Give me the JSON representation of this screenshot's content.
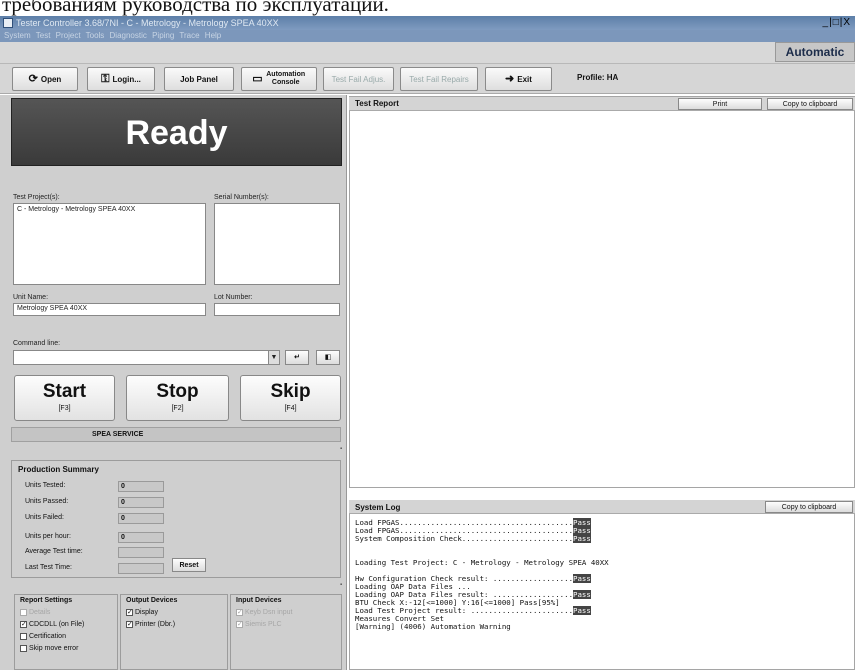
{
  "caption": "требованиям руководства по эксплуатации.",
  "window": {
    "title": "Tester Controller 3.68/7NI - C - Metrology - Metrology SPEA 40XX",
    "controls": "_|□|X"
  },
  "menu": "System  Test Project  Tools  Diagnostic  Piping Trace  Help",
  "mode_badge": "Automatic",
  "toolbar": {
    "open": "Open",
    "login": "Login...",
    "job_panel": "Job Panel",
    "automation_console": "Automation Console",
    "test_fail_adjust": "Test Fail Adjus.",
    "test_fail_repairs": "Test Fail Repairs",
    "exit": "Exit",
    "profile": "Profile: HA"
  },
  "status_banner": "Ready",
  "fields": {
    "test_project_label": "Test Project(s):",
    "test_project_value": "C - Metrology - Metrology SPEA 40XX",
    "serial_label": "Serial Number(s):",
    "serial_value": "",
    "unit_name_label": "Unit Name:",
    "unit_name_value": "Metrology SPEA 40XX",
    "lot_label": "Lot Number:",
    "lot_value": "",
    "command_label": "Command line:"
  },
  "buttons": {
    "start": "Start",
    "start_key": "[F3]",
    "stop": "Stop",
    "stop_key": "[F2]",
    "skip": "Skip",
    "skip_key": "[F4]"
  },
  "service_text": "SPEA SERVICE",
  "production": {
    "title": "Production Summary",
    "tested_label": "Units Tested:",
    "tested": "0",
    "passed_label": "Units Passed:",
    "passed": "0",
    "failed_label": "Units Failed:",
    "failed": "0",
    "per_hour_label": "Units per hour:",
    "per_hour": "0",
    "avg_label": "Average Test time:",
    "avg": "",
    "last_label": "Last Test Time:",
    "last": "",
    "reset": "Reset"
  },
  "report_settings": {
    "title": "Report Settings",
    "opts": [
      {
        "label": "Details",
        "checked": false,
        "disabled": true
      },
      {
        "label": "CDCDLL (on File)",
        "checked": true,
        "disabled": false
      },
      {
        "label": "Certification",
        "checked": false,
        "disabled": false
      },
      {
        "label": "Skip move error",
        "checked": false,
        "disabled": false
      }
    ]
  },
  "output_devices": {
    "title": "Output Devices",
    "opts": [
      {
        "label": "Display",
        "checked": true
      },
      {
        "label": "Printer (Dbr.)",
        "checked": true
      }
    ]
  },
  "input_devices": {
    "title": "Input Devices",
    "opts": [
      {
        "label": "Keyb Dsn input",
        "checked": true
      },
      {
        "label": "Siemis PLC",
        "checked": true
      }
    ]
  },
  "test_report": {
    "title": "Test Report",
    "print": "Print",
    "copy": "Copy to clipboard"
  },
  "system_log": {
    "title": "System Log",
    "copy": "Copy to clipboard",
    "lines": [
      {
        "text": "Load FPGAS.......................................",
        "status": "Pass"
      },
      {
        "text": "Load FPGAS.......................................",
        "status": "Pass"
      },
      {
        "text": "System Composition Check.........................",
        "status": "Pass"
      },
      {
        "text": "",
        "status": ""
      },
      {
        "text": "",
        "status": ""
      },
      {
        "text": "Loading Test Project: C - Metrology - Metrology SPEA 40XX",
        "status": ""
      },
      {
        "text": "",
        "status": ""
      },
      {
        "text": "Hw Configuration Check result: ..................",
        "status": "Pass"
      },
      {
        "text": "Loading OAP Data Files ...",
        "status": ""
      },
      {
        "text": "Loading OAP Data Files result: ..................",
        "status": "Pass"
      },
      {
        "text": "BTU Check X:-12[<=1000] Y:16[<=1000] Pass[95%]",
        "status": ""
      },
      {
        "text": "Load Test Project result: .......................",
        "status": "Pass"
      },
      {
        "text": "Measures Convert Set",
        "status": ""
      },
      {
        "text": "[Warning] (4006) Automation Warning",
        "status": ""
      }
    ]
  }
}
